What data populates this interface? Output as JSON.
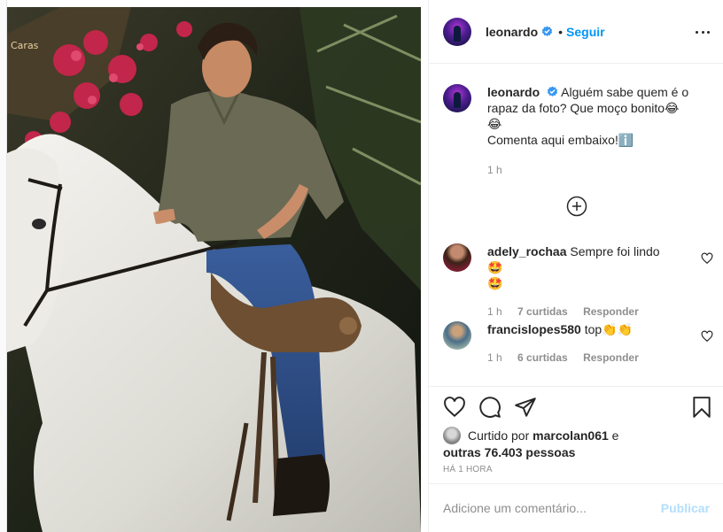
{
  "post": {
    "author": "leonardo",
    "follow_label": "Seguir",
    "dot": "•",
    "watermark": "Caras",
    "caption": "Alguém sabe quem é o rapaz da foto? Que moço bonito😂\n😂\nComenta aqui embaixo!ℹ️",
    "caption_time": "1 h"
  },
  "comments": [
    {
      "username": "adely_rochaa",
      "text": "Sempre foi lindo🤩\n🤩",
      "time": "1 h",
      "likes": "7 curtidas",
      "reply": "Responder"
    },
    {
      "username": "francislopes580",
      "text": "top👏👏",
      "time": "1 h",
      "likes": "6 curtidas",
      "reply": "Responder"
    }
  ],
  "likes": {
    "prefix": "Curtido por",
    "user": "marcolan061",
    "joiner": "e",
    "others": "outras 76.403 pessoas"
  },
  "timestamp": "HÁ 1 HORA",
  "add_comment": {
    "placeholder": "Adicione um comentário...",
    "post_label": "Publicar"
  },
  "colors": {
    "accent": "#0095f6",
    "verified": "#3897f0",
    "muted": "#8e8e8e",
    "post_disabled": "#b2dffc"
  },
  "icons": [
    "verified-badge-icon",
    "more-options-icon",
    "load-more-comments-icon",
    "heart-icon",
    "comment-icon",
    "share-icon",
    "save-bookmark-icon"
  ]
}
